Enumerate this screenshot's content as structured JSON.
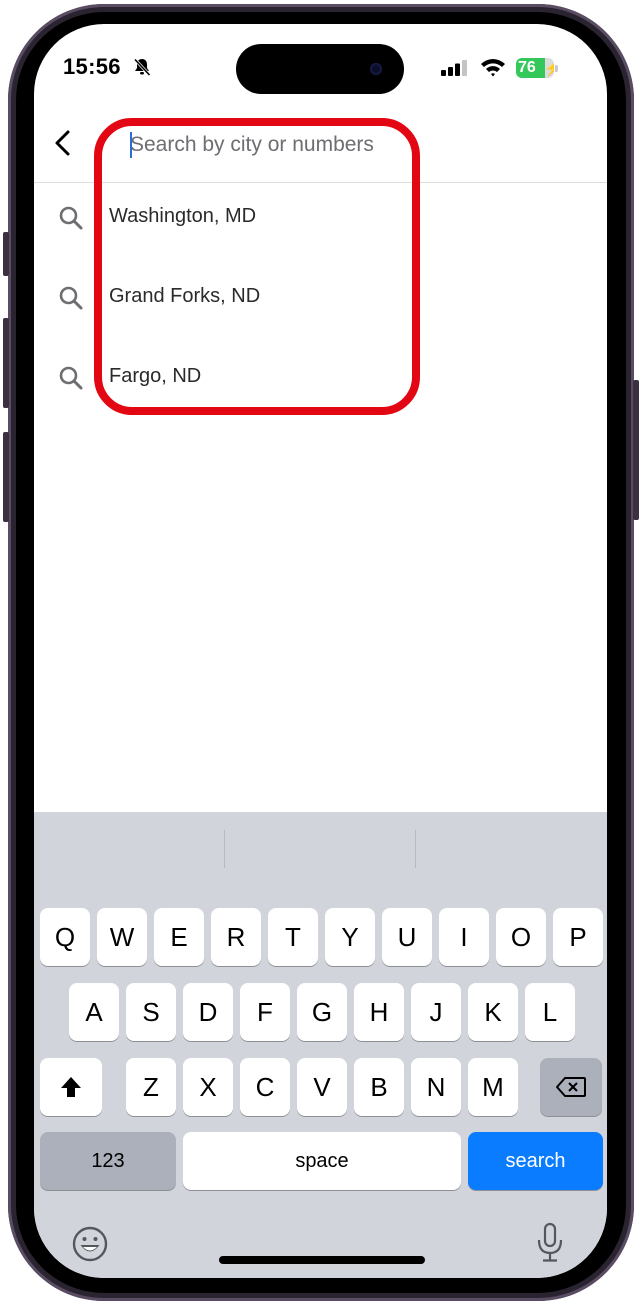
{
  "status_bar": {
    "time": "15:56",
    "silent_icon": "bell-slash-icon",
    "signal_icon": "cellular-signal-icon",
    "wifi_icon": "wifi-icon",
    "battery_percent": "76",
    "battery_level": 0.76,
    "battery_charging": true
  },
  "header": {
    "back_icon": "chevron-left-icon",
    "search": {
      "value": "",
      "placeholder": "Search by city or numbers"
    }
  },
  "suggestions": [
    {
      "icon": "search-icon",
      "label": "Washington, MD"
    },
    {
      "icon": "search-icon",
      "label": "Grand Forks, ND"
    },
    {
      "icon": "search-icon",
      "label": "Fargo, ND"
    }
  ],
  "annotation": {
    "highlight_color": "#e30613"
  },
  "keyboard": {
    "row1": [
      "Q",
      "W",
      "E",
      "R",
      "T",
      "Y",
      "U",
      "I",
      "O",
      "P"
    ],
    "row2": [
      "A",
      "S",
      "D",
      "F",
      "G",
      "H",
      "J",
      "K",
      "L"
    ],
    "row3": [
      "Z",
      "X",
      "C",
      "V",
      "B",
      "N",
      "M"
    ],
    "shift_icon": "shift-icon",
    "delete_icon": "delete-backward-icon",
    "numbers_label": "123",
    "space_label": "space",
    "search_label": "search",
    "emoji_icon": "emoji-icon",
    "mic_icon": "microphone-icon",
    "accent_color": "#0a7cff"
  }
}
